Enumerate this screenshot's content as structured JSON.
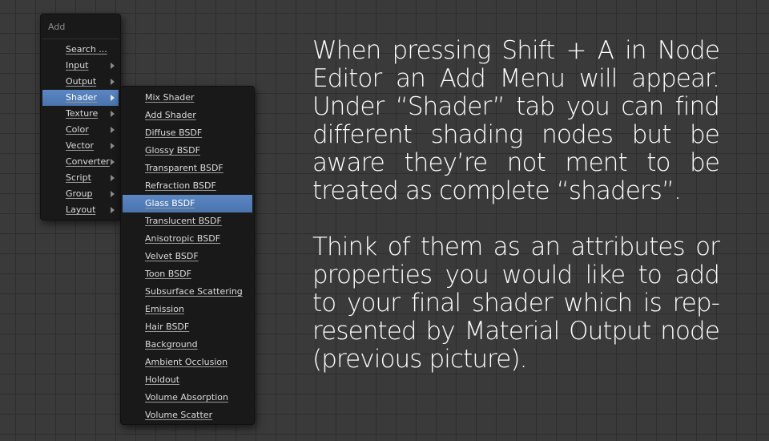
{
  "add_menu": {
    "title": "Add",
    "items": [
      {
        "label": "Search ...",
        "submenu": false
      },
      {
        "label": "Input",
        "submenu": true
      },
      {
        "label": "Output",
        "submenu": true
      },
      {
        "label": "Shader",
        "submenu": true,
        "selected": true
      },
      {
        "label": "Texture",
        "submenu": true
      },
      {
        "label": "Color",
        "submenu": true
      },
      {
        "label": "Vector",
        "submenu": true
      },
      {
        "label": "Converter",
        "submenu": true
      },
      {
        "label": "Script",
        "submenu": true
      },
      {
        "label": "Group",
        "submenu": true
      },
      {
        "label": "Layout",
        "submenu": true
      }
    ]
  },
  "shader_menu": {
    "items": [
      {
        "label": "Mix Shader"
      },
      {
        "label": "Add Shader"
      },
      {
        "label": "Diffuse BSDF"
      },
      {
        "label": "Glossy BSDF"
      },
      {
        "label": "Transparent BSDF"
      },
      {
        "label": "Refraction BSDF"
      },
      {
        "label": "Glass BSDF",
        "selected": true
      },
      {
        "label": "Translucent BSDF"
      },
      {
        "label": "Anisotropic BSDF"
      },
      {
        "label": "Velvet BSDF"
      },
      {
        "label": "Toon BSDF"
      },
      {
        "label": "Subsurface Scattering"
      },
      {
        "label": "Emission"
      },
      {
        "label": "Hair BSDF"
      },
      {
        "label": "Background"
      },
      {
        "label": "Ambient Occlusion"
      },
      {
        "label": "Holdout"
      },
      {
        "label": "Volume Absorption"
      },
      {
        "label": "Volume Scatter"
      }
    ]
  },
  "description": {
    "paragraph_1": "When pressing Shift + A in Node Editor an Add Menu will appear. Under “Shader” tab you can find different shading nodes but be aware they’re not  ment to be treated as complete “shaders”.",
    "paragraph_2": "Think of them as an attributes or properties you would like to add to your final shader which is rep-resented by Material Output node (previous picture)."
  },
  "colors": {
    "background": "#3a3a3a",
    "menu_background": "#191919",
    "selection": "#5680bd"
  }
}
